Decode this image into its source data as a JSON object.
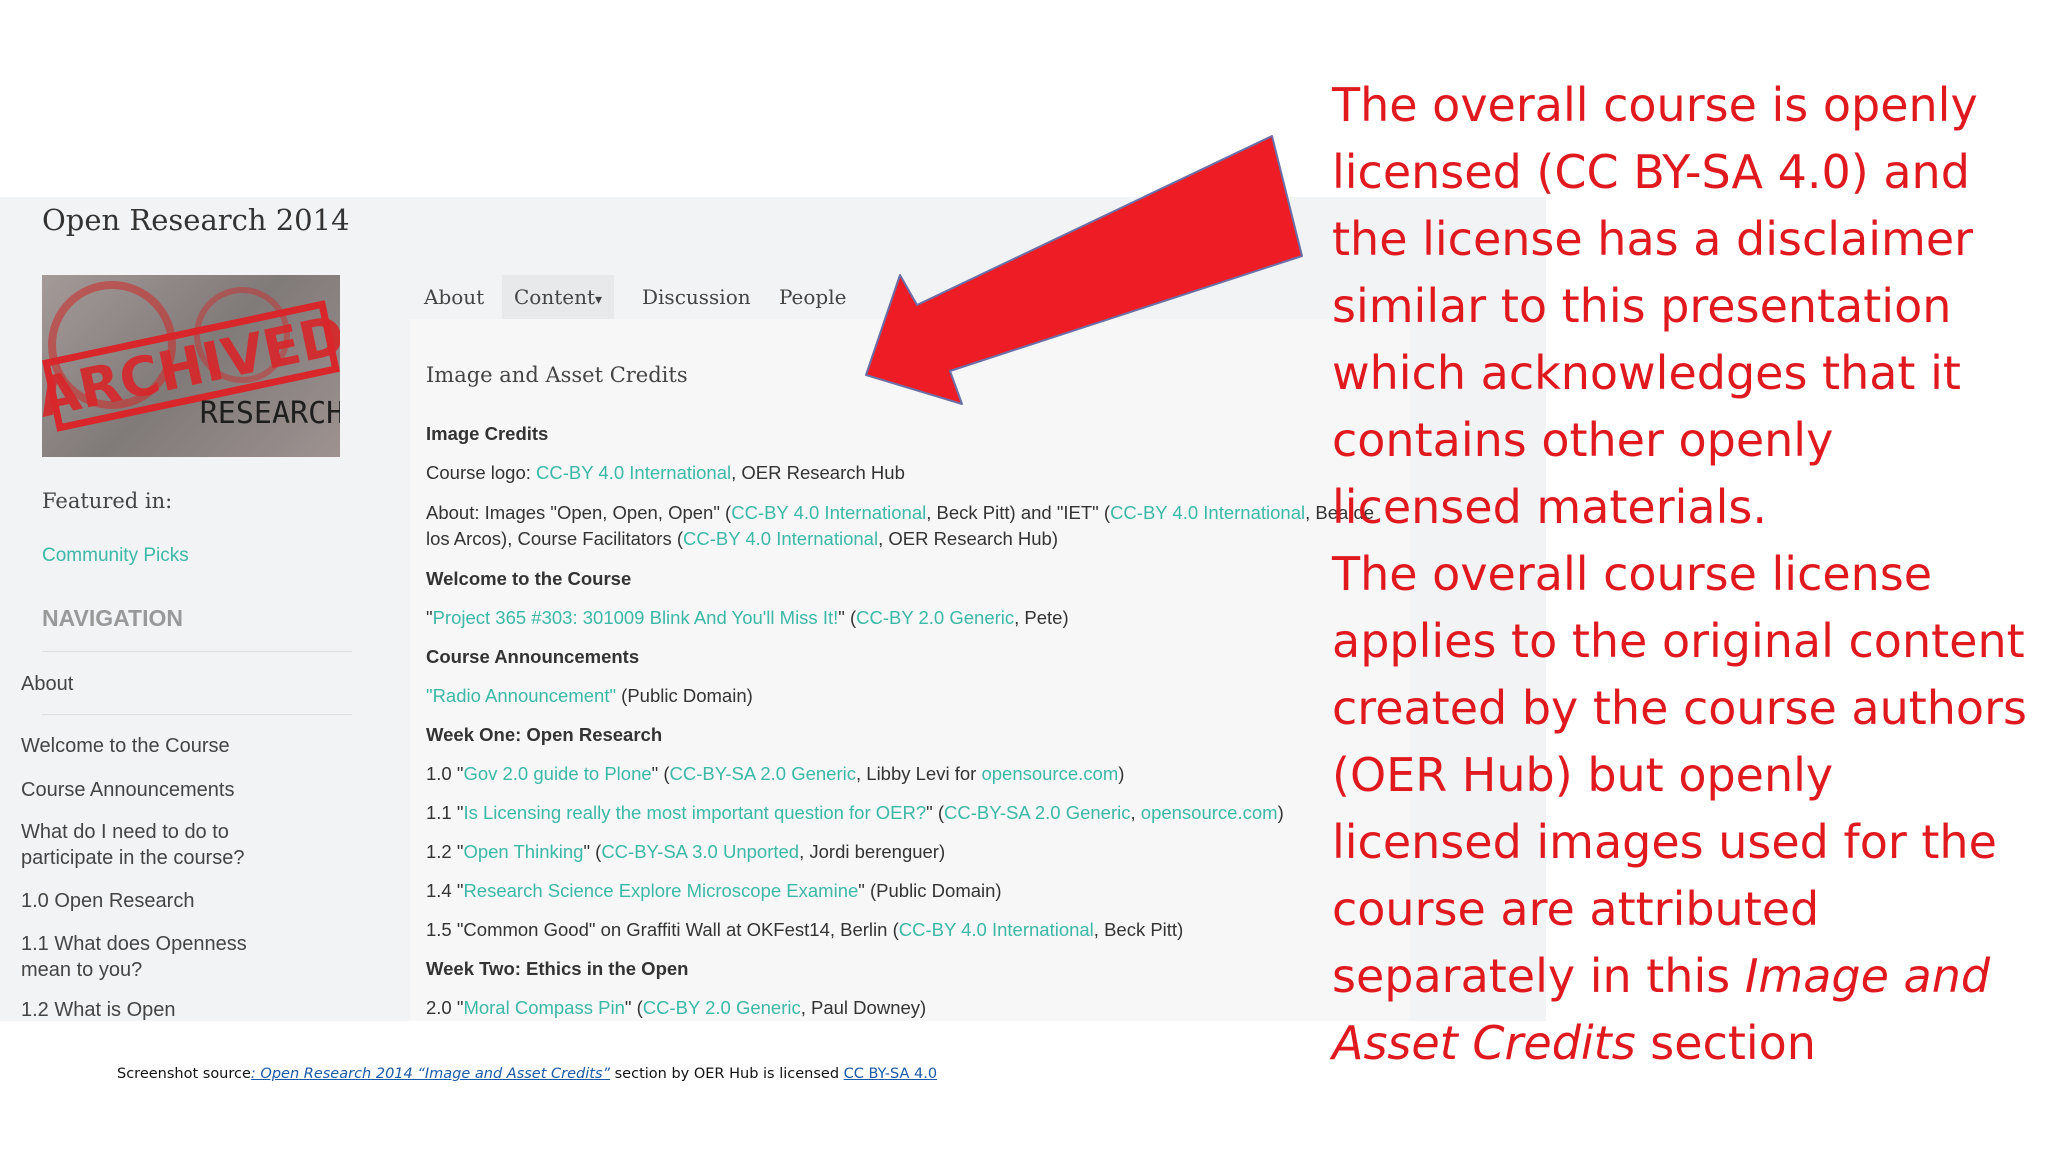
{
  "site": {
    "title": "Open Research 2014",
    "logo_alt_text": "ARCHIVED RESEARCH",
    "featured_label": "Featured in:",
    "featured_link": "Community Picks",
    "nav_heading": "NAVIGATION",
    "nav_items": [
      "About",
      "Welcome to the Course",
      "Course Announcements",
      "What do I need to do to participate in the course?",
      "1.0 Open Research",
      "1.1 What does Openness mean to you?",
      "1.2 What is Open"
    ]
  },
  "tabs": [
    "About",
    "Content",
    "Discussion",
    "People"
  ],
  "tab_caret": "▾",
  "content": {
    "title": "Image and Asset Credits",
    "image_credits_heading": "Image Credits",
    "course_logo": {
      "prefix": "Course logo: ",
      "license": "CC-BY 4.0 International",
      "suffix": ", OER Research Hub"
    },
    "about_line1": {
      "a": "About: Images \"Open, Open, Open\" (",
      "l1": "CC-BY 4.0 International",
      "b": ", Beck Pitt) and \"IET\" (",
      "l2": "CC-BY 4.0 International",
      "c": ", Bea de"
    },
    "about_line2": {
      "a": "los Arcos), Course Facilitators (",
      "l1": "CC-BY 4.0 International",
      "b": ", OER Research Hub)"
    },
    "welcome_heading": "Welcome to the Course",
    "welcome_line": {
      "q1": "\"",
      "title": "Project 365 #303: 301009 Blink And You'll Miss It!",
      "q2": "\" (",
      "license": "CC-BY 2.0 Generic",
      "rest": ", Pete)"
    },
    "announcements_heading": "Course Announcements",
    "announcement_line": {
      "title": "\"Radio Announcement\"",
      "rest": " (Public Domain)"
    },
    "week_one_heading": "Week One: Open Research",
    "w1_0": {
      "a": "1.0 \"",
      "title": "Gov 2.0 guide to Plone",
      "b": "\" (",
      "license": "CC-BY-SA 2.0 Generic",
      "c": ", Libby Levi for ",
      "site": "opensource.com",
      "d": ")"
    },
    "w1_1": {
      "a": "1.1 \"",
      "title": "Is Licensing really the most important question for OER?",
      "b": "\" (",
      "license": "CC-BY-SA 2.0 Generic",
      "c": ", ",
      "site": "opensource.com",
      "d": ")"
    },
    "w1_2": {
      "a": "1.2 \"",
      "title": "Open Thinking",
      "b": "\" (",
      "license": "CC-BY-SA 3.0 Unported",
      "c": ", Jordi berenguer)"
    },
    "w1_4": {
      "a": "1.4 \"",
      "title": "Research Science Explore Microscope Examine",
      "b": "\" (Public Domain)"
    },
    "w1_5": {
      "a": "1.5 \"Common Good\" on Graffiti Wall at OKFest14, Berlin (",
      "license": "CC-BY 4.0 International",
      "b": ", Beck Pitt)"
    },
    "week_two_heading": "Week Two: Ethics in the Open",
    "w2_0": {
      "a": "2.0 \"",
      "title": "Moral Compass Pin",
      "b": "\" (",
      "license": "CC-BY 2.0 Generic",
      "c": ", Paul Downey)"
    }
  },
  "annotation": {
    "para1": "The overall course is openly licensed (CC BY-SA 4.0) and the license has a disclaimer similar to this presentation which acknowledges that it contains other openly licensed materials.",
    "para2_start": "The overall course license applies to the original content created by the course authors (OER Hub) but openly licensed images used for the course are attributed separately in this ",
    "para2_italic": "Image and Asset Credits",
    "para2_end": " section"
  },
  "source": {
    "prefix": "Screenshot source",
    "link1": ": Open Research 2014 “Image and Asset Credits”",
    "middle": " section by OER Hub is licensed ",
    "link2": "CC BY-SA 4.0"
  },
  "colors": {
    "annotation": "#e0191f",
    "arrow": "#ee1c24",
    "link_green": "#3cb8a7",
    "link_blue": "#1a5aa6"
  }
}
